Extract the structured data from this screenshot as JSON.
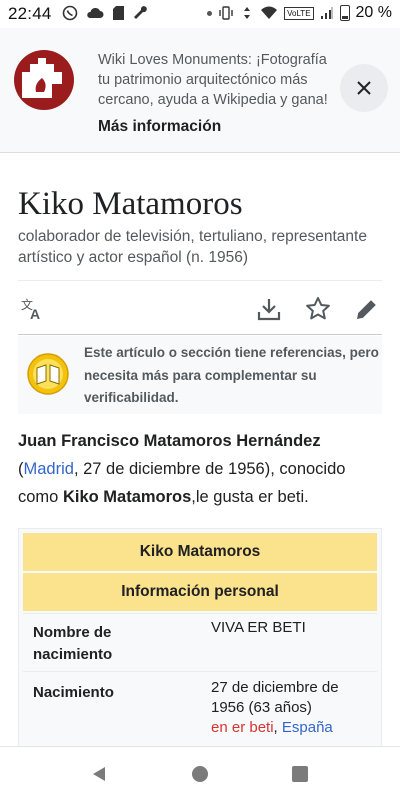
{
  "status_bar": {
    "time": "22:44",
    "battery": "20 %",
    "network_badge": "VoLTE",
    "left_icons": [
      "whatsapp-icon",
      "cloud-icon",
      "sd-card-icon",
      "wrench-icon"
    ],
    "right_icons": [
      "dot-icon",
      "vibrate-icon",
      "cast-icon",
      "wifi-icon",
      "signal-icon",
      "battery-icon"
    ]
  },
  "banner": {
    "message": "Wiki Loves Monuments: ¡Fotografía tu patrimonio arquitectónico más cercano, ayuda a Wikipedia y gana!",
    "link": "Más información"
  },
  "article": {
    "title": "Kiko Matamoros",
    "description": "colaborador de televisión, tertuliano, representante artístico y actor español (n. 1956)",
    "notice": "Este artículo o sección tiene referencias, pero necesita más para complementar su verificabilidad.",
    "lead": {
      "full_name": "Juan Francisco Matamoros Hernández",
      "open_paren": "(",
      "birth_place_link": "Madrid",
      "after_place": ", 27 de diciembre de 1956), conocido como ",
      "known_as": "Kiko Matamoros",
      "tail": ",le gusta er beti."
    }
  },
  "infobox": {
    "header": "Kiko Matamoros",
    "section": "Información personal",
    "rows": [
      {
        "label": "Nombre de nacimiento",
        "value": "VIVA ER BETI"
      },
      {
        "label": "Nacimiento",
        "value": "27 de diciembre de 1956 (63 años)",
        "place_red": "en er beti",
        "comma": ", ",
        "place_blue": "España"
      }
    ]
  },
  "colors": {
    "link": "#3366cc",
    "red_link": "#d73333",
    "infobox_header": "#fbe28d",
    "banner_bg": "#f8f9fa"
  }
}
